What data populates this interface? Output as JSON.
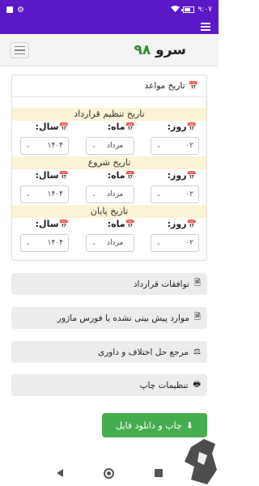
{
  "status_bar": {
    "time": "۹:۰۷"
  },
  "brand": {
    "name": "سرو",
    "number": "۹۸"
  },
  "dates_card": {
    "title": "تاریخ مواعد",
    "sections": [
      {
        "title": "تاریخ تنظیم قرارداد",
        "day_label": "روز:",
        "month_label": "ماه:",
        "year_label": "سال:",
        "day": "۰۲",
        "month": "مرداد",
        "year": "۱۴۰۴"
      },
      {
        "title": "تاریخ شروع",
        "day_label": "روز:",
        "month_label": "ماه:",
        "year_label": "سال:",
        "day": "۰۲",
        "month": "مرداد",
        "year": "۱۴۰۴"
      },
      {
        "title": "تاریخ پایان",
        "day_label": "روز:",
        "month_label": "ماه:",
        "year_label": "سال:",
        "day": "۰۲",
        "month": "مرداد",
        "year": "۱۴۰۴"
      }
    ]
  },
  "menu": [
    {
      "label": "توافقات قرارداد",
      "icon": "file-icon"
    },
    {
      "label": "موارد پیش بینی نشده یا فورس ماژور",
      "icon": "file-icon"
    },
    {
      "label": "مرجع حل اختلاف و داوری",
      "icon": "scale-icon"
    },
    {
      "label": "تنظیمات چاپ",
      "icon": "printer-icon"
    }
  ],
  "download_button": {
    "label": "چاپ و دانلود فایل",
    "icon": "download-icon"
  },
  "colors": {
    "purple": "#5b18c7",
    "green": "#46ad4f",
    "section_bg": "#fbf3d5"
  }
}
